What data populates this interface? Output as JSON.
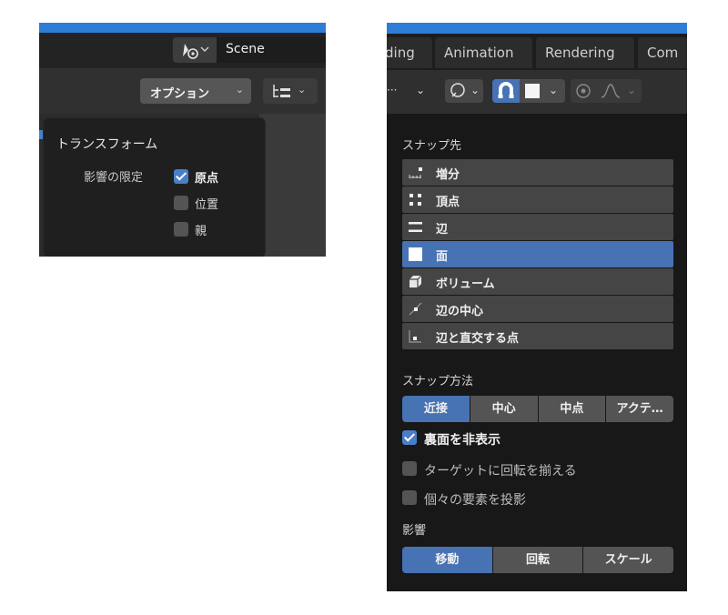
{
  "left": {
    "scene": {
      "name": "Scene"
    },
    "header": {
      "options_label": "オプション",
      "chevron": "⌄"
    },
    "popup": {
      "title": "トランスフォーム",
      "affect_label": "影響の限定",
      "options": [
        {
          "label": "原点",
          "checked": true
        },
        {
          "label": "位置",
          "checked": false
        },
        {
          "label": "親",
          "checked": false
        }
      ]
    }
  },
  "right": {
    "tabs": [
      "ding",
      "Animation",
      "Rendering",
      "Com"
    ],
    "toolbar": {
      "dots": "···",
      "chevron": "⌄"
    },
    "popup": {
      "snap_to_title": "スナップ先",
      "snap_to_items": [
        {
          "label": "増分",
          "icon": "increment-icon",
          "selected": false
        },
        {
          "label": "頂点",
          "icon": "vertex-icon",
          "selected": false
        },
        {
          "label": "辺",
          "icon": "edge-icon",
          "selected": false
        },
        {
          "label": "面",
          "icon": "face-icon",
          "selected": true
        },
        {
          "label": "ボリューム",
          "icon": "volume-icon",
          "selected": false
        },
        {
          "label": "辺の中心",
          "icon": "edge-center-icon",
          "selected": false
        },
        {
          "label": "辺と直交する点",
          "icon": "edge-perpendicular-icon",
          "selected": false
        }
      ],
      "snap_with_title": "スナップ方法",
      "snap_with_options": [
        {
          "label": "近接",
          "selected": true
        },
        {
          "label": "中心",
          "selected": false
        },
        {
          "label": "中点",
          "selected": false
        },
        {
          "label": "アクテ…",
          "selected": false
        }
      ],
      "checkboxes": [
        {
          "label": "裏面を非表示",
          "checked": true
        },
        {
          "label": "ターゲットに回転を揃える",
          "checked": false
        },
        {
          "label": "個々の要素を投影",
          "checked": false
        }
      ],
      "affect_title": "影響",
      "affect_options": [
        {
          "label": "移動",
          "selected": true
        },
        {
          "label": "回転",
          "selected": false
        },
        {
          "label": "スケール",
          "selected": false
        }
      ]
    }
  },
  "colors": {
    "accent": "#4772b3",
    "title_bar": "#2e7dd7",
    "panel": "#181818"
  }
}
